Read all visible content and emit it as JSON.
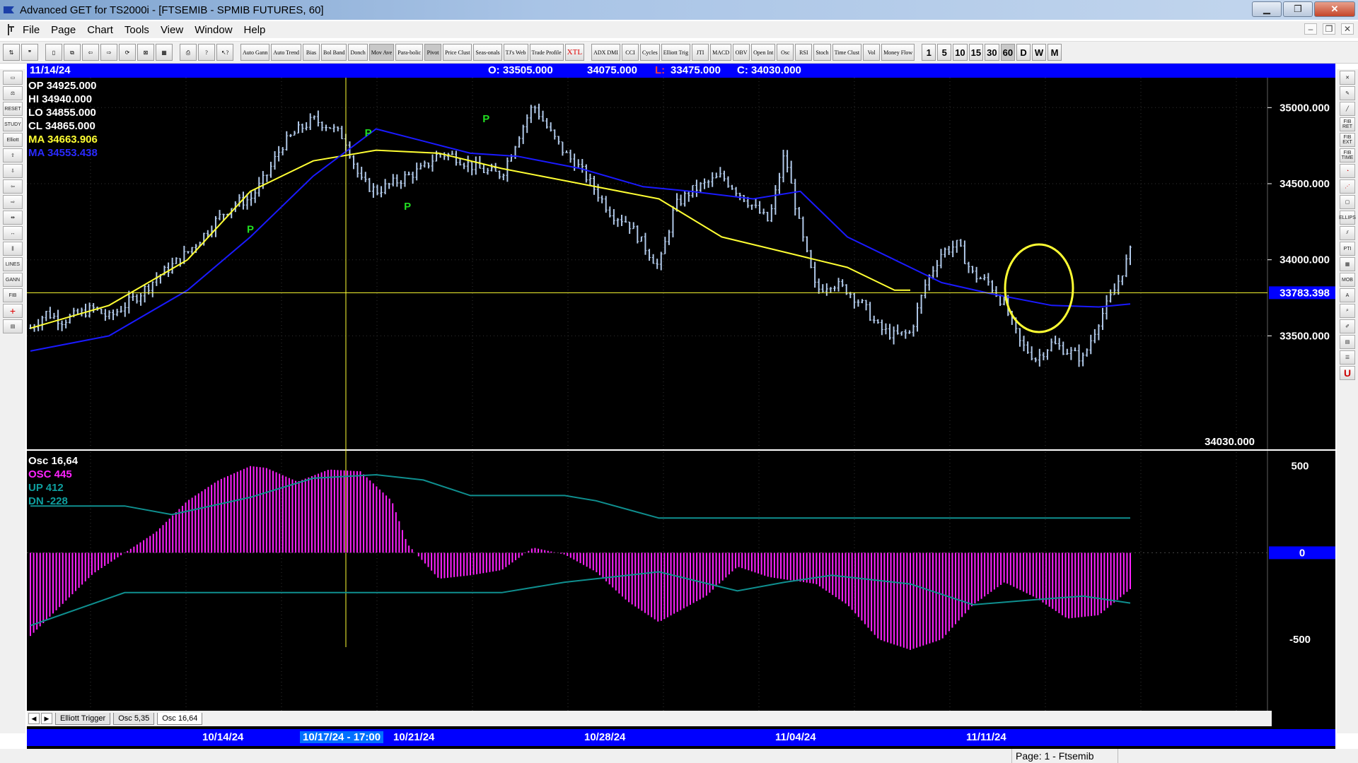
{
  "window": {
    "title": "Advanced GET for TS2000i - [FTSEMIB - SPMIB FUTURES, 60]"
  },
  "menu": {
    "items": [
      "File",
      "Page",
      "Chart",
      "Tools",
      "View",
      "Window",
      "Help"
    ]
  },
  "toolbar": {
    "study_buttons": [
      "Auto Gann",
      "Auto Trend",
      "Bias",
      "Bol Band",
      "Donch",
      "Mov Ave",
      "Para-bolic",
      "Pivot",
      "Price Clust",
      "Seas-onals",
      "TJ's Web",
      "Trade Profile",
      "XTL",
      "ADX DMI",
      "CCI",
      "Cycles",
      "Elliott Trig",
      "JTI",
      "MACD",
      "OBV",
      "Open Int",
      "Osc",
      "RSI",
      "Stoch",
      "Time Clust",
      "Vol",
      "Money Flow"
    ],
    "intervals": [
      "1",
      "5",
      "10",
      "15",
      "30",
      "60",
      "D",
      "W",
      "M"
    ]
  },
  "left_tools": [
    "RESET",
    "STUDY",
    "Elliott",
    "LINES",
    "GANN",
    "FIB"
  ],
  "right_tools": [
    "FIB RET",
    "FIB EXT",
    "FIB TIME",
    "ELLIPS",
    "PTI",
    "MOB",
    "A",
    "U"
  ],
  "infobar": {
    "date": "11/14/24",
    "open": "O: 33505.000",
    "high": "34075.000",
    "low_label": "L:",
    "low": "33475.000",
    "close": "C: 34030.000"
  },
  "legend": {
    "op": "OP  34925.000",
    "hi": "HI   34940.000",
    "lo": "LO  34855.000",
    "cl": "CL   34865.000",
    "ma1": "MA  34663.906",
    "ma2": "MA  34553.438"
  },
  "osc_legend": {
    "title": "Osc 16,64",
    "osc": "OSC 445",
    "up": "UP   412",
    "dn": "DN   -228"
  },
  "price_axis": {
    "ticks": [
      {
        "v": 35000,
        "label": "35000.000"
      },
      {
        "v": 34500,
        "label": "34500.000"
      },
      {
        "v": 34000,
        "label": "34000.000"
      },
      {
        "v": 33500,
        "label": "33500.000"
      }
    ],
    "crosshair_value": 33783.398,
    "crosshair_label": "33783.398",
    "last_price_label": "34030.000"
  },
  "osc_axis": {
    "ticks": [
      {
        "v": 500,
        "label": "500"
      },
      {
        "v": 0,
        "label": "0"
      },
      {
        "v": -500,
        "label": "-500"
      }
    ]
  },
  "dates": {
    "d1": "10/14/24",
    "d2": "10/17/24 - 17:00",
    "d3": "10/21/24",
    "d4": "10/28/24",
    "d5": "11/04/24",
    "d6": "11/11/24"
  },
  "tabs": [
    "Elliott Trigger",
    "Osc 5,35",
    "Osc 16,64"
  ],
  "status": {
    "page": "Page: 1 - Ftsemib"
  },
  "colors": {
    "background": "#000000",
    "price_bars": "#b0c8e8",
    "ma_yellow": "#ffff33",
    "ma_blue": "#1a1aff",
    "osc": "#ff22ff",
    "bands": "#0f8f8f",
    "pivot": "#22dd22"
  },
  "chart_data": {
    "type": "bar",
    "title": "FTSEMIB - SPMIB FUTURES, 60",
    "ylim": [
      33200,
      35150
    ],
    "pivots": [
      {
        "label": "P",
        "x": 28,
        "kind": "low"
      },
      {
        "label": "P",
        "x": 43,
        "kind": "high"
      },
      {
        "label": "P",
        "x": 48,
        "kind": "low"
      },
      {
        "label": "P",
        "x": 58,
        "kind": "high"
      }
    ],
    "close_path": [
      [
        0,
        33550
      ],
      [
        2,
        33650
      ],
      [
        4,
        33600
      ],
      [
        6,
        33640
      ],
      [
        8,
        33680
      ],
      [
        10,
        33620
      ],
      [
        12,
        33700
      ],
      [
        14,
        33780
      ],
      [
        16,
        33880
      ],
      [
        18,
        33960
      ],
      [
        20,
        34050
      ],
      [
        22,
        34160
      ],
      [
        24,
        34280
      ],
      [
        26,
        34370
      ],
      [
        28,
        34400
      ],
      [
        30,
        34550
      ],
      [
        32,
        34750
      ],
      [
        34,
        34850
      ],
      [
        36,
        34920
      ],
      [
        38,
        34880
      ],
      [
        40,
        34800
      ],
      [
        42,
        34520
      ],
      [
        44,
        34450
      ],
      [
        46,
        34500
      ],
      [
        48,
        34550
      ],
      [
        50,
        34600
      ],
      [
        52,
        34700
      ],
      [
        54,
        34680
      ],
      [
        56,
        34620
      ],
      [
        58,
        34580
      ],
      [
        60,
        34560
      ],
      [
        62,
        34800
      ],
      [
        64,
        35020
      ],
      [
        66,
        34850
      ],
      [
        68,
        34700
      ],
      [
        70,
        34600
      ],
      [
        72,
        34450
      ],
      [
        74,
        34300
      ],
      [
        76,
        34250
      ],
      [
        78,
        34100
      ],
      [
        80,
        33950
      ],
      [
        82,
        34350
      ],
      [
        84,
        34450
      ],
      [
        86,
        34500
      ],
      [
        88,
        34550
      ],
      [
        90,
        34450
      ],
      [
        92,
        34350
      ],
      [
        94,
        34250
      ],
      [
        96,
        34700
      ],
      [
        98,
        34200
      ],
      [
        100,
        33800
      ],
      [
        102,
        33850
      ],
      [
        104,
        33800
      ],
      [
        106,
        33700
      ],
      [
        108,
        33550
      ],
      [
        110,
        33500
      ],
      [
        112,
        33520
      ],
      [
        114,
        33850
      ],
      [
        116,
        34050
      ],
      [
        118,
        34100
      ],
      [
        120,
        33900
      ],
      [
        122,
        33850
      ],
      [
        124,
        33700
      ],
      [
        126,
        33450
      ],
      [
        128,
        33350
      ],
      [
        130,
        33450
      ],
      [
        132,
        33400
      ],
      [
        134,
        33350
      ],
      [
        136,
        33600
      ],
      [
        138,
        33800
      ],
      [
        140,
        34050
      ]
    ],
    "ma_yellow": [
      [
        0,
        33550
      ],
      [
        10,
        33700
      ],
      [
        20,
        34000
      ],
      [
        28,
        34450
      ],
      [
        36,
        34650
      ],
      [
        44,
        34720
      ],
      [
        52,
        34700
      ],
      [
        60,
        34600
      ],
      [
        70,
        34500
      ],
      [
        80,
        34400
      ],
      [
        88,
        34150
      ],
      [
        96,
        34050
      ],
      [
        104,
        33950
      ],
      [
        110,
        33800
      ],
      [
        112,
        33800
      ]
    ],
    "ma_blue": [
      [
        0,
        33400
      ],
      [
        10,
        33500
      ],
      [
        20,
        33800
      ],
      [
        28,
        34150
      ],
      [
        36,
        34550
      ],
      [
        44,
        34860
      ],
      [
        50,
        34780
      ],
      [
        56,
        34700
      ],
      [
        62,
        34680
      ],
      [
        70,
        34600
      ],
      [
        78,
        34480
      ],
      [
        84,
        34450
      ],
      [
        92,
        34400
      ],
      [
        98,
        34450
      ],
      [
        104,
        34150
      ],
      [
        110,
        34000
      ],
      [
        116,
        33850
      ],
      [
        122,
        33780
      ],
      [
        130,
        33700
      ],
      [
        136,
        33690
      ],
      [
        140,
        33710
      ]
    ],
    "osc": [
      [
        0,
        -480
      ],
      [
        4,
        -300
      ],
      [
        8,
        -120
      ],
      [
        12,
        0
      ],
      [
        16,
        120
      ],
      [
        20,
        300
      ],
      [
        24,
        420
      ],
      [
        28,
        500
      ],
      [
        30,
        490
      ],
      [
        34,
        410
      ],
      [
        38,
        480
      ],
      [
        42,
        470
      ],
      [
        46,
        300
      ],
      [
        48,
        50
      ],
      [
        52,
        -150
      ],
      [
        56,
        -130
      ],
      [
        60,
        -100
      ],
      [
        64,
        30
      ],
      [
        68,
        -10
      ],
      [
        72,
        -110
      ],
      [
        76,
        -280
      ],
      [
        80,
        -400
      ],
      [
        86,
        -250
      ],
      [
        90,
        -80
      ],
      [
        94,
        -140
      ],
      [
        100,
        -180
      ],
      [
        104,
        -300
      ],
      [
        108,
        -500
      ],
      [
        112,
        -560
      ],
      [
        116,
        -500
      ],
      [
        120,
        -300
      ],
      [
        124,
        -170
      ],
      [
        128,
        -260
      ],
      [
        132,
        -380
      ],
      [
        136,
        -360
      ],
      [
        140,
        -210
      ]
    ],
    "osc_up": [
      [
        0,
        270
      ],
      [
        12,
        270
      ],
      [
        18,
        220
      ],
      [
        28,
        320
      ],
      [
        36,
        430
      ],
      [
        44,
        450
      ],
      [
        50,
        420
      ],
      [
        56,
        330
      ],
      [
        68,
        330
      ],
      [
        72,
        300
      ],
      [
        80,
        200
      ],
      [
        140,
        200
      ]
    ],
    "osc_dn": [
      [
        0,
        -420
      ],
      [
        12,
        -230
      ],
      [
        60,
        -230
      ],
      [
        68,
        -170
      ],
      [
        80,
        -110
      ],
      [
        90,
        -220
      ],
      [
        96,
        -170
      ],
      [
        102,
        -130
      ],
      [
        112,
        -180
      ],
      [
        120,
        -300
      ],
      [
        128,
        -270
      ],
      [
        134,
        -250
      ],
      [
        140,
        -290
      ]
    ],
    "osc_ylim": [
      -520,
      560
    ]
  }
}
